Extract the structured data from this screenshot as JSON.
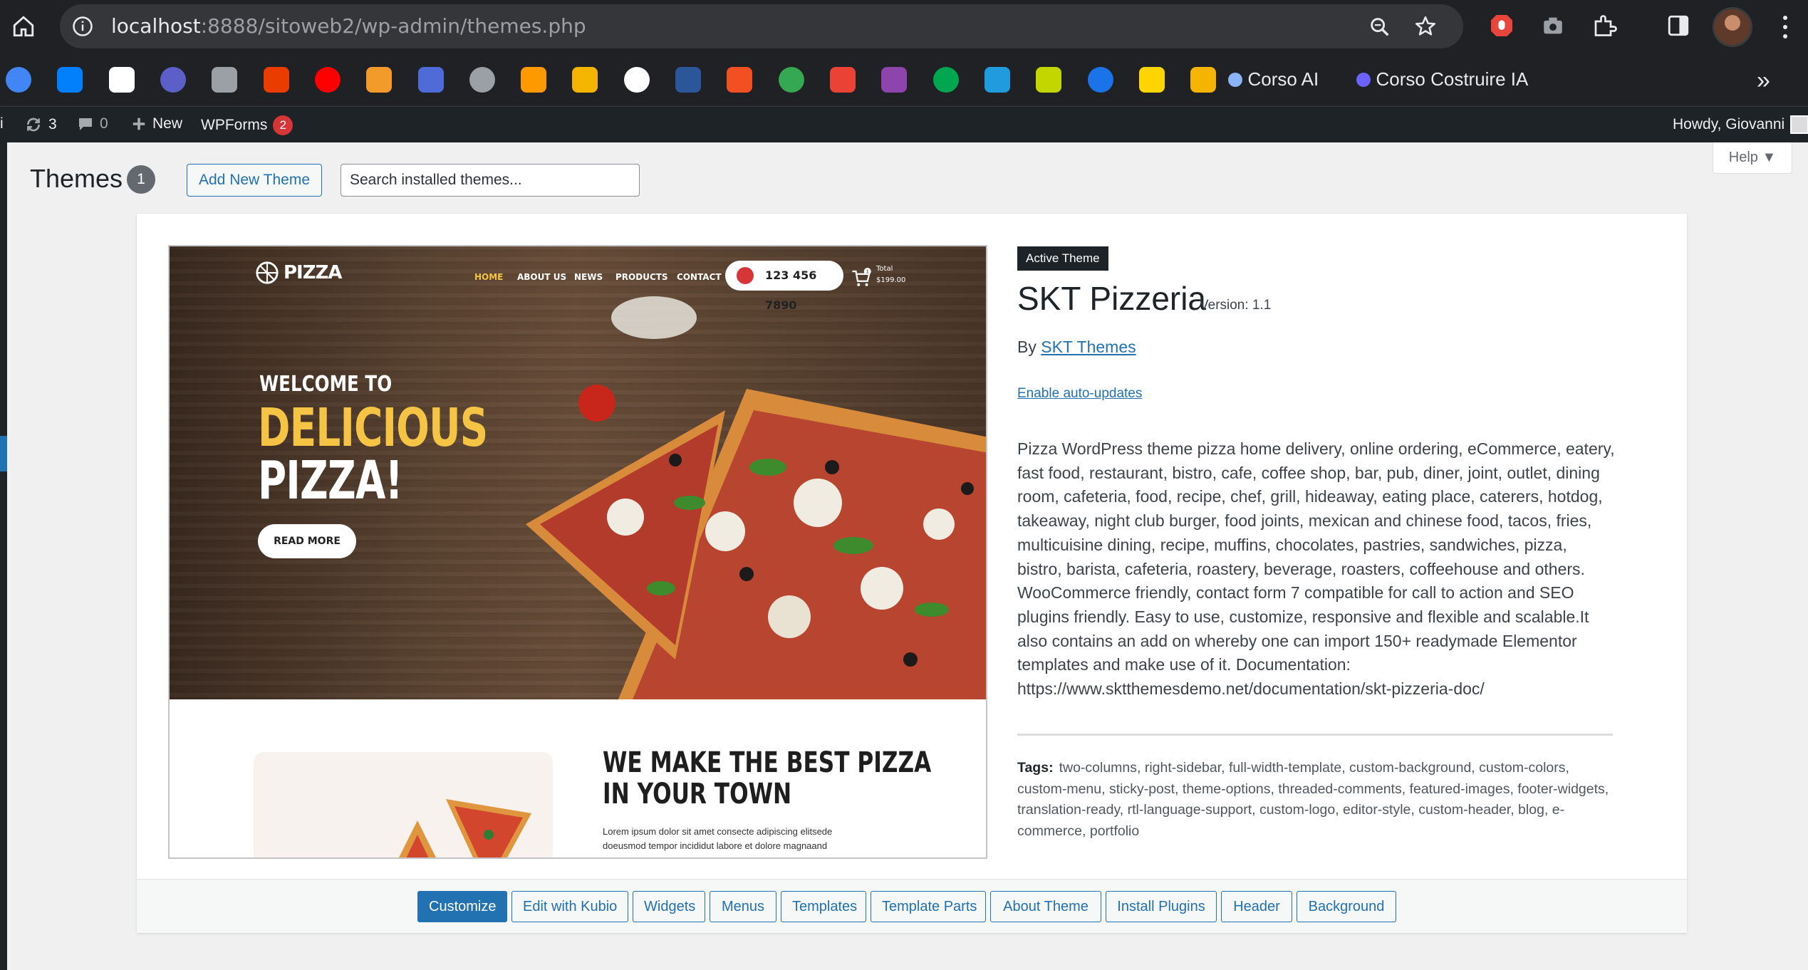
{
  "browser": {
    "url_host": "localhost",
    "url_path": ":8888/sitoweb2/wp-admin/themes.php",
    "bookmarks": [
      {
        "label": "Corso AI",
        "color": "#8ab4f8"
      },
      {
        "label": "Corso Costruire IA",
        "color": "#6c63ff"
      }
    ],
    "bookmark_icon_colors": [
      "#4285f4",
      "#0081fb",
      "#ffffff",
      "#5b5fc7",
      "#9aa0a6",
      "#eb3c00",
      "#ff0000",
      "#f29b2b",
      "#4f6bd8",
      "#9aa0a6",
      "#ff9900",
      "#f4b400",
      "#ffffff",
      "#2b579a",
      "#f25022",
      "#34a853",
      "#ea4335",
      "#8e44ad",
      "#00a650",
      "#1f9bde",
      "#c4d600",
      "#1a73e8",
      "#ffd500",
      "#f4b400"
    ]
  },
  "adminbar": {
    "updates_count": "3",
    "comments_count": "0",
    "new_label": "New",
    "wpforms_label": "WPForms",
    "wpforms_count": "2",
    "howdy": "Howdy, Giovanni",
    "site_initial": "i"
  },
  "page": {
    "title": "Themes",
    "theme_count": "1",
    "add_new_label": "Add New Theme",
    "search_placeholder": "Search installed themes...",
    "help_label": "Help ▼"
  },
  "theme": {
    "active_label": "Active Theme",
    "name": "SKT Pizzeria",
    "version": "Version: 1.1",
    "by": "By ",
    "author": "SKT Themes",
    "auto_updates": "Enable auto-updates",
    "description": "Pizza WordPress theme pizza home delivery, online ordering, eCommerce, eatery, fast food, restaurant, bistro, cafe, coffee shop, bar, pub, diner, joint, outlet, dining room, cafeteria, food, recipe, chef, grill, hideaway, eating place, caterers, hotdog, takeaway, night club burger, food joints, mexican and chinese food, tacos, fries, multicuisine dining, recipe, muffins, chocolates, pastries, sandwiches, pizza, bistro, barista, cafeteria, roastery, beverage, roasters, coffeehouse and others. WooCommerce friendly, contact form 7 compatible for call to action and SEO plugins friendly. Easy to use, customize, responsive and flexible and scalable.It also contains an add on whereby one can import 150+ readymade Elementor templates and make use of it. Documentation: https://www.sktthemesdemo.net/documentation/skt-pizzeria-doc/",
    "tags_label": "Tags:",
    "tags": "two-columns, right-sidebar, full-width-template, custom-background, custom-colors, custom-menu, sticky-post, theme-options, threaded-comments, featured-images, footer-widgets, translation-ready, rtl-language-support, custom-logo, editor-style, custom-header, blog, e-commerce, portfolio"
  },
  "preview": {
    "logo": "PIZZA",
    "nav": [
      "HOME",
      "ABOUT US",
      "NEWS",
      "PRODUCTS",
      "CONTACT"
    ],
    "phone": "123 456 7890",
    "cart_count": "1",
    "total_label": "Total",
    "total_value": "$199.00",
    "welcome": "WELCOME TO",
    "headline_1": "DELICIOUS",
    "headline_2": "PIZZA!",
    "read_more": "READ MORE",
    "section_heading_1": "WE MAKE THE BEST PIZZA",
    "section_heading_2": "IN YOUR TOWN",
    "section_body_1": "Lorem ipsum dolor sit amet consecte adipiscing elitsede",
    "section_body_2": "doeusmod tempor incididut labore et dolore magnaand"
  },
  "actions": [
    "Customize",
    "Edit with Kubio",
    "Widgets",
    "Menus",
    "Templates",
    "Template Parts",
    "About Theme",
    "Install Plugins",
    "Header",
    "Background"
  ]
}
